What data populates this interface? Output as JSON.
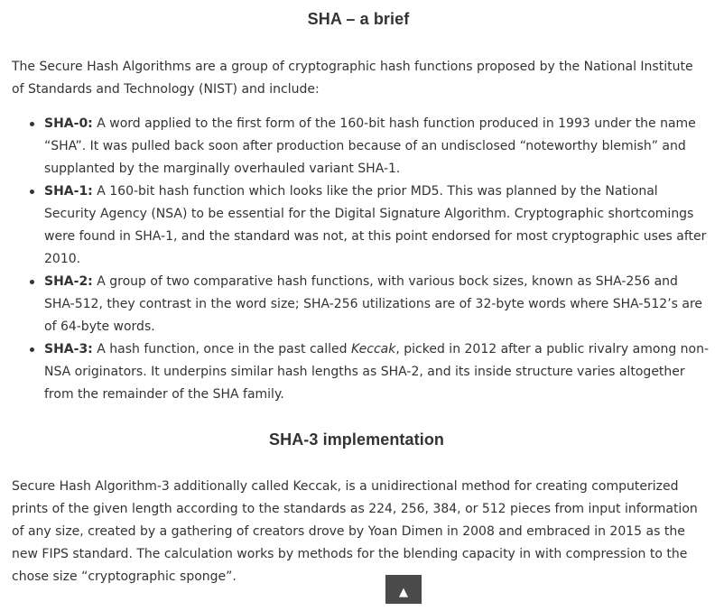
{
  "section1": {
    "title": "SHA – a brief",
    "intro": "The Secure Hash Algorithms are a group of cryptographic hash functions proposed by the National Institute of Standards and Technology (NIST) and include:",
    "items": [
      {
        "label": "SHA-0:",
        "text_before": " A word applied to the first form of the 160-bit hash function produced in 1993 under the name “SHA”. It was pulled back soon after production because of an undisclosed “noteworthy blemish” and supplanted by the marginally overhauled variant SHA-1.",
        "emphasis": "",
        "text_after": ""
      },
      {
        "label": "SHA-1:",
        "text_before": " A 160-bit hash function which looks like the prior MD5. This was planned by the National Security Agency (NSA) to be essential for the Digital Signature Algorithm. Cryptographic shortcomings were found in SHA-1, and the standard was not, at this point endorsed for most cryptographic uses after 2010.",
        "emphasis": "",
        "text_after": ""
      },
      {
        "label": "SHA-2:",
        "text_before": " A group of two comparative hash functions, with various bock sizes, known as SHA-256 and SHA-512, they contrast in the word size; SHA-256 utilizations are of 32-byte words where SHA-512’s are of 64-byte words.",
        "emphasis": "",
        "text_after": ""
      },
      {
        "label": "SHA-3:",
        "text_before": " A hash function, once in the past called ",
        "emphasis": "Keccak",
        "text_after": ", picked in 2012 after a public rivalry among non-NSA originators. It underpins similar hash lengths as SHA-2, and its inside structure varies altogether from the remainder of the SHA family."
      }
    ]
  },
  "section2": {
    "title": "SHA-3 implementation",
    "body": "Secure Hash Algorithm-3 additionally called Keccak, is a unidirectional method for creating computerized prints of the given length according to the standards as 224, 256, 384, or 512 pieces from input information of any size, created by a gathering of creators drove by Yoan Dimen in 2008 and embraced in 2015 as the new FIPS standard. The calculation works by methods for the blending capacity in with compression to the chose size “cryptographic sponge”."
  },
  "back_to_top": {
    "icon": "▲",
    "icon_name": "arrow-up-icon"
  }
}
